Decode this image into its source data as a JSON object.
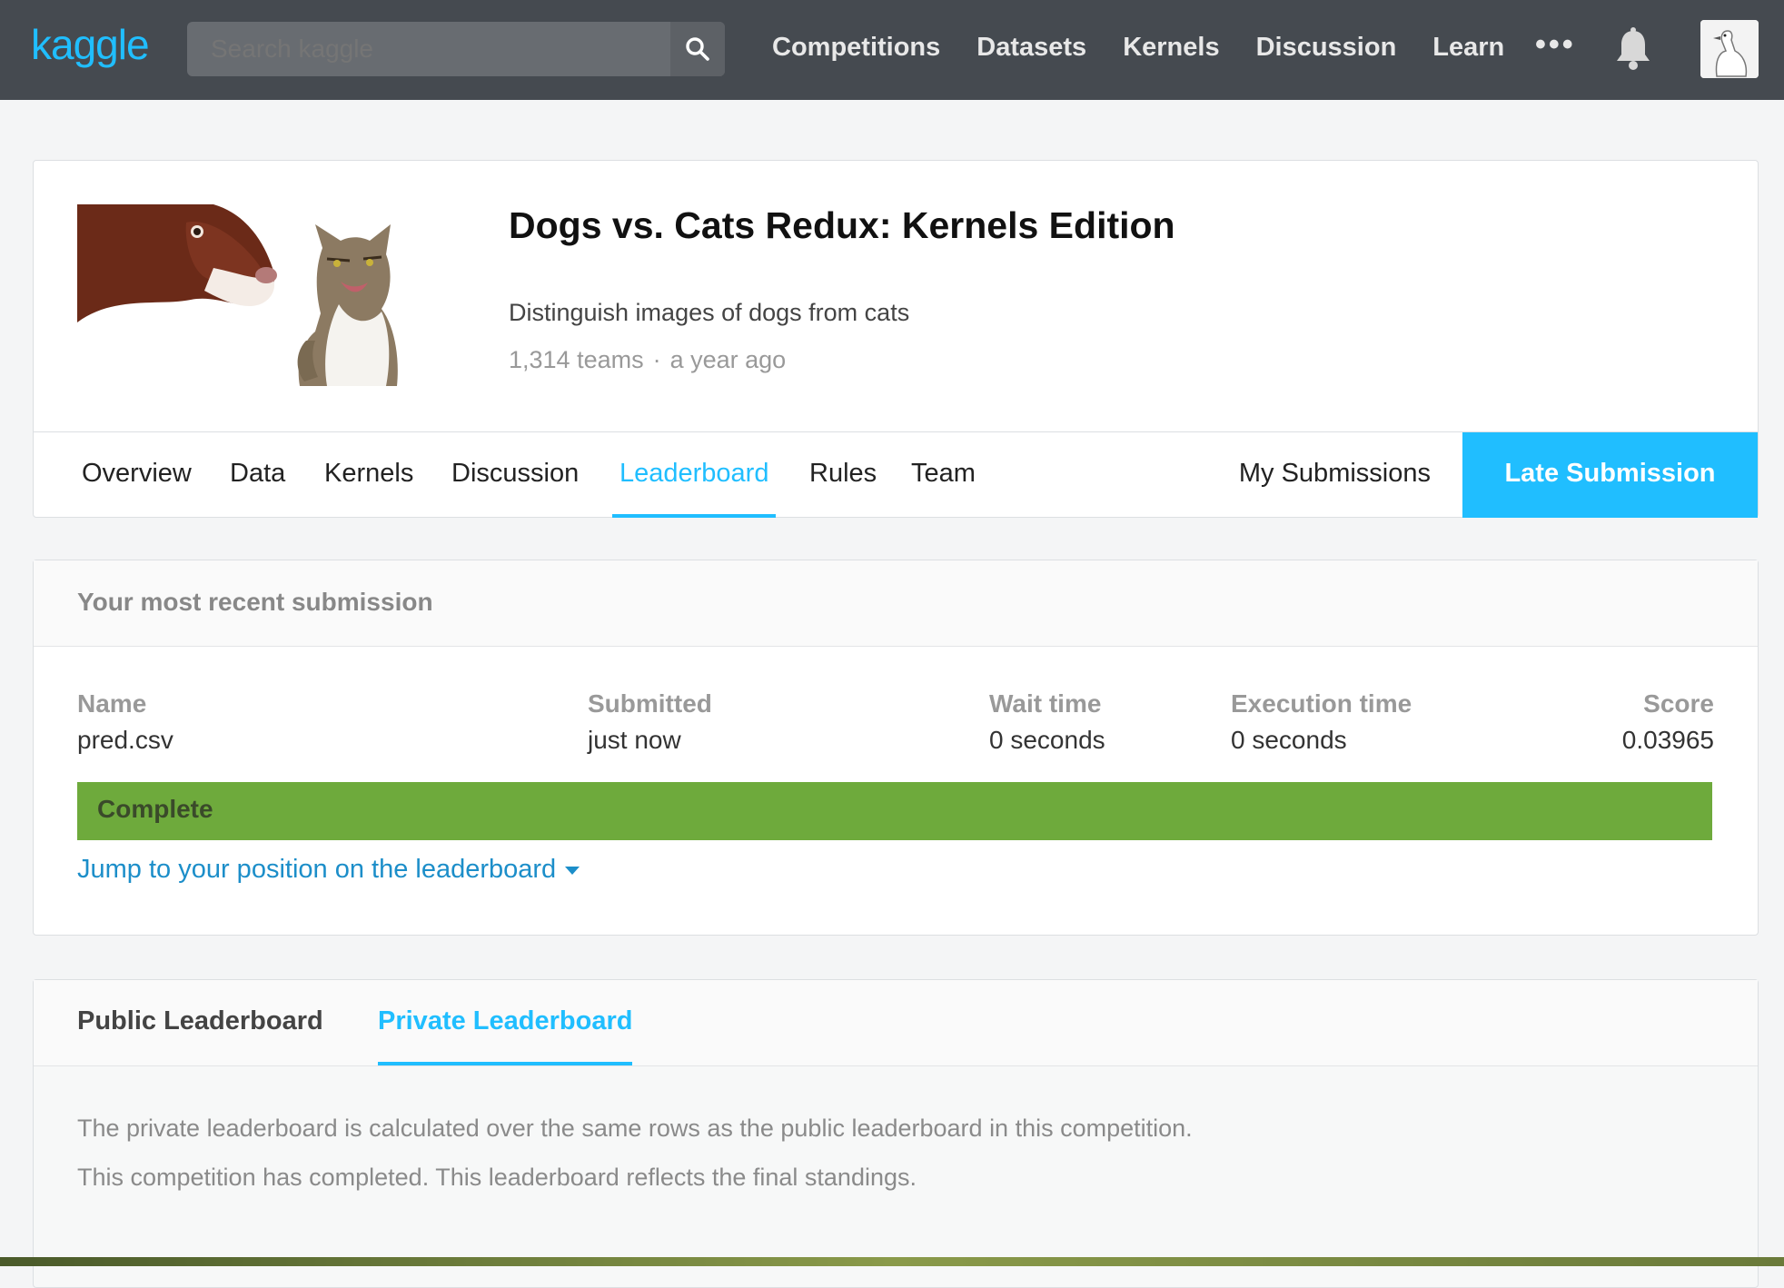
{
  "topnav": {
    "logo": "kaggle",
    "search_placeholder": "Search kaggle",
    "links": [
      "Competitions",
      "Datasets",
      "Kernels",
      "Discussion",
      "Learn"
    ],
    "more_label": "•••"
  },
  "competition": {
    "title": "Dogs vs. Cats Redux: Kernels Edition",
    "description": "Distinguish images of dogs from cats",
    "teams": "1,314 teams",
    "separator": "·",
    "age": "a year ago"
  },
  "subnav": {
    "tabs": [
      "Overview",
      "Data",
      "Kernels",
      "Discussion",
      "Leaderboard",
      "Rules",
      "Team"
    ],
    "active_tab": "Leaderboard",
    "my_submissions": "My Submissions",
    "late_submission": "Late Submission"
  },
  "submission": {
    "heading": "Your most recent submission",
    "columns": [
      {
        "header": "Name",
        "value": "pred.csv"
      },
      {
        "header": "Submitted",
        "value": "just now"
      },
      {
        "header": "Wait time",
        "value": "0 seconds"
      },
      {
        "header": "Execution time",
        "value": "0 seconds"
      },
      {
        "header": "Score",
        "value": "0.03965"
      }
    ],
    "status": "Complete",
    "jump_link": "Jump to your position on the leaderboard"
  },
  "leaderboard": {
    "tabs": [
      "Public Leaderboard",
      "Private Leaderboard"
    ],
    "active_tab": "Private Leaderboard",
    "notes": [
      "The private leaderboard is calculated over the same rows as the public leaderboard in this competition.",
      "This competition has completed. This leaderboard reflects the final standings."
    ]
  },
  "colors": {
    "accent": "#20beff",
    "nav_bg": "#454a50",
    "status_complete": "#6eaa3c",
    "link": "#1c8ec9"
  }
}
